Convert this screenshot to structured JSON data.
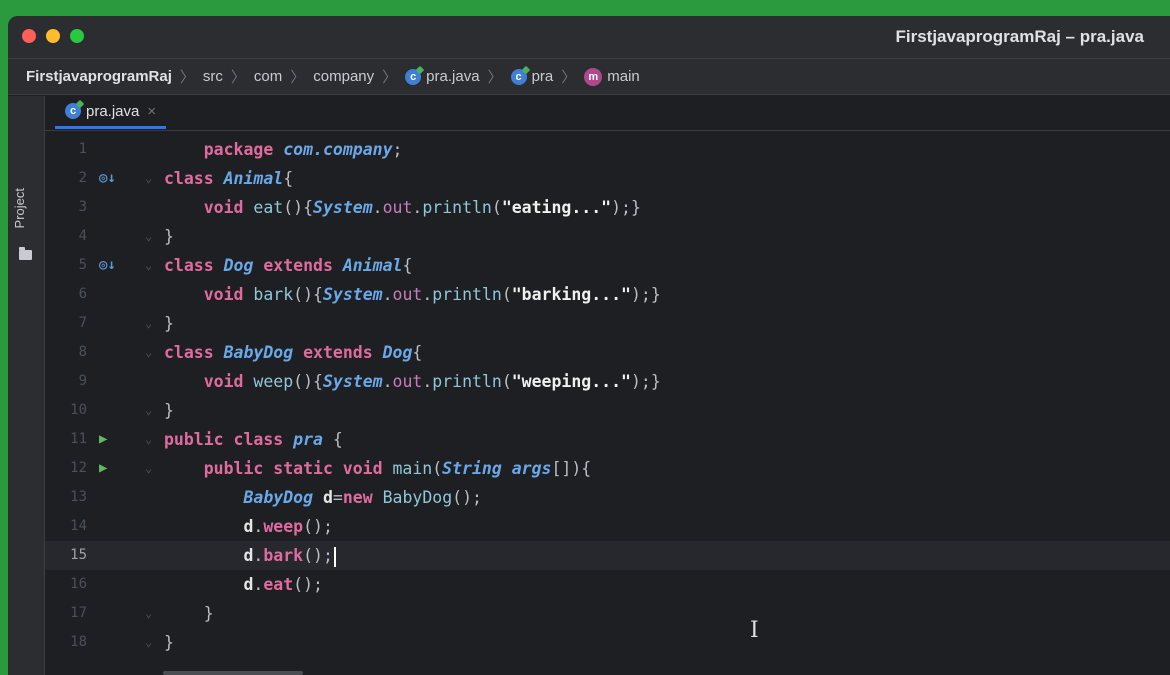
{
  "window": {
    "title": "FirstjavaprogramRaj – pra.java"
  },
  "breadcrumb": [
    {
      "label": "FirstjavaprogramRaj",
      "icon": ""
    },
    {
      "label": "src",
      "icon": ""
    },
    {
      "label": "com",
      "icon": ""
    },
    {
      "label": "company",
      "icon": ""
    },
    {
      "label": "pra.java",
      "icon": "class-icon"
    },
    {
      "label": "pra",
      "icon": "class-icon"
    },
    {
      "label": "main",
      "icon": "method-icon"
    }
  ],
  "toolstrip": {
    "project_label": "Project"
  },
  "tab": {
    "label": "pra.java",
    "close": "×"
  },
  "editor": {
    "current_line": 15,
    "lines": [
      {
        "n": "1",
        "gutter": "",
        "fold": false,
        "tokens": [
          [
            "    ",
            ""
          ],
          [
            "package ",
            "kw2"
          ],
          [
            "com.company",
            "ty"
          ],
          [
            ";",
            ""
          ]
        ]
      },
      {
        "n": "2",
        "gutter": "override",
        "fold": true,
        "tokens": [
          [
            "class ",
            "kw2"
          ],
          [
            "Animal",
            "ty"
          ],
          [
            "{",
            ""
          ]
        ]
      },
      {
        "n": "3",
        "gutter": "",
        "fold": false,
        "tokens": [
          [
            "    void ",
            "kw2"
          ],
          [
            "eat",
            "fn"
          ],
          [
            "(){",
            ""
          ],
          [
            "System",
            "ty"
          ],
          [
            ".",
            ""
          ],
          [
            "out",
            "fld"
          ],
          [
            ".",
            ""
          ],
          [
            "println",
            "fn"
          ],
          [
            "(",
            ""
          ],
          [
            "\"eating...\"",
            "st"
          ],
          [
            ");}",
            ""
          ]
        ]
      },
      {
        "n": "4",
        "gutter": "",
        "fold": true,
        "tokens": [
          [
            "}",
            ""
          ]
        ]
      },
      {
        "n": "5",
        "gutter": "override",
        "fold": true,
        "tokens": [
          [
            "class ",
            "kw2"
          ],
          [
            "Dog ",
            "ty"
          ],
          [
            "extends ",
            "kw2"
          ],
          [
            "Animal",
            "ty"
          ],
          [
            "{",
            ""
          ]
        ]
      },
      {
        "n": "6",
        "gutter": "",
        "fold": false,
        "tokens": [
          [
            "    void ",
            "kw2"
          ],
          [
            "bark",
            "fn"
          ],
          [
            "(){",
            ""
          ],
          [
            "System",
            "ty"
          ],
          [
            ".",
            ""
          ],
          [
            "out",
            "fld"
          ],
          [
            ".",
            ""
          ],
          [
            "println",
            "fn"
          ],
          [
            "(",
            ""
          ],
          [
            "\"barking...\"",
            "st"
          ],
          [
            ");}",
            ""
          ]
        ]
      },
      {
        "n": "7",
        "gutter": "",
        "fold": true,
        "tokens": [
          [
            "}",
            ""
          ]
        ]
      },
      {
        "n": "8",
        "gutter": "",
        "fold": true,
        "tokens": [
          [
            "class ",
            "kw2"
          ],
          [
            "BabyDog ",
            "ty"
          ],
          [
            "extends ",
            "kw2"
          ],
          [
            "Dog",
            "ty"
          ],
          [
            "{",
            ""
          ]
        ]
      },
      {
        "n": "9",
        "gutter": "",
        "fold": false,
        "tokens": [
          [
            "    void ",
            "kw2"
          ],
          [
            "weep",
            "fn"
          ],
          [
            "(){",
            ""
          ],
          [
            "System",
            "ty"
          ],
          [
            ".",
            ""
          ],
          [
            "out",
            "fld"
          ],
          [
            ".",
            ""
          ],
          [
            "println",
            "fn"
          ],
          [
            "(",
            ""
          ],
          [
            "\"weeping...\"",
            "st"
          ],
          [
            ");}",
            ""
          ]
        ]
      },
      {
        "n": "10",
        "gutter": "",
        "fold": true,
        "tokens": [
          [
            "}",
            ""
          ]
        ]
      },
      {
        "n": "11",
        "gutter": "run",
        "fold": true,
        "tokens": [
          [
            "public class ",
            "kw2"
          ],
          [
            "pra",
            "ty"
          ],
          [
            " {",
            ""
          ]
        ]
      },
      {
        "n": "12",
        "gutter": "run",
        "fold": true,
        "tokens": [
          [
            "    public static void ",
            "kw2"
          ],
          [
            "main",
            "fn"
          ],
          [
            "(",
            ""
          ],
          [
            "String ",
            "ty"
          ],
          [
            "args",
            "ty"
          ],
          [
            "[]){",
            ""
          ]
        ]
      },
      {
        "n": "13",
        "gutter": "",
        "fold": false,
        "tokens": [
          [
            "        ",
            ""
          ],
          [
            "BabyDog ",
            "ty"
          ],
          [
            "d",
            "var"
          ],
          [
            "=",
            ""
          ],
          [
            "new ",
            "kw2"
          ],
          [
            "BabyDog",
            "fn"
          ],
          [
            "();",
            ""
          ]
        ]
      },
      {
        "n": "14",
        "gutter": "",
        "fold": false,
        "tokens": [
          [
            "        ",
            ""
          ],
          [
            "d",
            "var"
          ],
          [
            ".",
            ""
          ],
          [
            "weep",
            "kw2"
          ],
          [
            "();",
            ""
          ]
        ]
      },
      {
        "n": "15",
        "gutter": "",
        "fold": false,
        "tokens": [
          [
            "        ",
            ""
          ],
          [
            "d",
            "var"
          ],
          [
            ".",
            ""
          ],
          [
            "bark",
            "kw2"
          ],
          [
            "();",
            ""
          ]
        ]
      },
      {
        "n": "16",
        "gutter": "",
        "fold": false,
        "tokens": [
          [
            "        ",
            ""
          ],
          [
            "d",
            "var"
          ],
          [
            ".",
            ""
          ],
          [
            "eat",
            "kw2"
          ],
          [
            "();",
            ""
          ]
        ]
      },
      {
        "n": "17",
        "gutter": "",
        "fold": true,
        "tokens": [
          [
            "    }",
            ""
          ]
        ]
      },
      {
        "n": "18",
        "gutter": "",
        "fold": true,
        "tokens": [
          [
            "}",
            ""
          ]
        ]
      }
    ]
  },
  "icons": {
    "override": "◎↓",
    "run": "▶",
    "fold": "⌄",
    "cursor": "I"
  },
  "colors": {
    "background": "#1e1f22",
    "keyword": "#e06c9f",
    "type": "#6aa8e8",
    "accent": "#3574f0",
    "run": "#5fb865"
  }
}
